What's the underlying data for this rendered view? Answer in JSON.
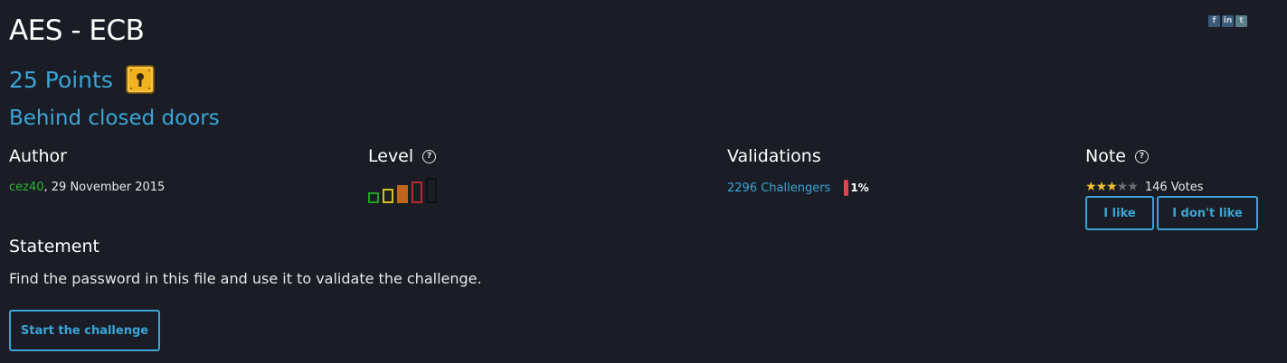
{
  "challenge": {
    "title": "AES - ECB",
    "points": "25 Points",
    "subtitle": "Behind closed doors"
  },
  "author": {
    "heading": "Author",
    "name": "cez40",
    "date": ",  29 November 2015"
  },
  "level": {
    "heading": "Level",
    "current": 3,
    "max": 5,
    "colors": [
      "#1ea21e",
      "#d6c21c",
      "#c0641a",
      "#b52a2a",
      "#444444"
    ]
  },
  "validations": {
    "heading": "Validations",
    "challengers": "2296 Challengers",
    "percent": "1%"
  },
  "note": {
    "heading": "Note",
    "stars_filled": 3,
    "stars_total": 5,
    "votes": "146 Votes",
    "like_label": "I like",
    "dislike_label": "I don't like"
  },
  "statement": {
    "heading": "Statement",
    "text": "Find the password in this file and use it to validate the challenge."
  },
  "start_label": "Start the challenge",
  "social": {
    "icons": [
      "facebook-icon",
      "linkedin-icon",
      "twitter-icon"
    ],
    "labels": [
      "f",
      "in",
      "t"
    ]
  },
  "colors": {
    "accent": "#3aa5d6",
    "background": "#1a1d26",
    "author_link": "#2fb52f",
    "percent_bar": "#e0444e"
  }
}
